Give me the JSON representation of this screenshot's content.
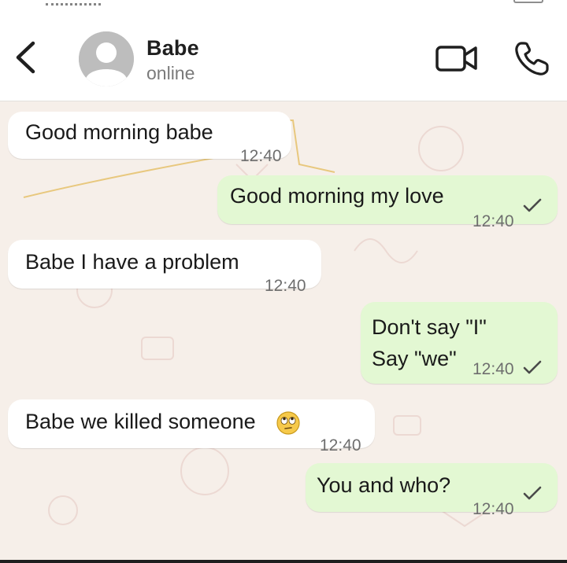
{
  "header": {
    "contact_name": "Babe",
    "contact_status": "online",
    "back_icon": "chevron-left-icon",
    "avatar_icon": "default-person-avatar",
    "video_icon": "video-camera-icon",
    "call_icon": "phone-icon"
  },
  "colors": {
    "incoming_bubble": "#ffffff",
    "outgoing_bubble": "#e3f8d3",
    "chat_background": "#f6efe9",
    "timestamp": "#6e6e6e"
  },
  "messages": [
    {
      "direction": "in",
      "text": "Good morning babe",
      "time": "12:40"
    },
    {
      "direction": "out",
      "text": "Good morning my love",
      "time": "12:40",
      "status": "sent"
    },
    {
      "direction": "in",
      "text": "Babe I have a problem",
      "time": "12:40"
    },
    {
      "direction": "out",
      "lines": [
        "Don't say \"I\"",
        "Say \"we\""
      ],
      "time": "12:40",
      "status": "sent"
    },
    {
      "direction": "in",
      "text": "Babe we killed someone",
      "emoji": "face-with-rolling-eyes",
      "time": "12:40"
    },
    {
      "direction": "out",
      "text": "You and who?",
      "time": "12:40",
      "status": "sent"
    }
  ]
}
